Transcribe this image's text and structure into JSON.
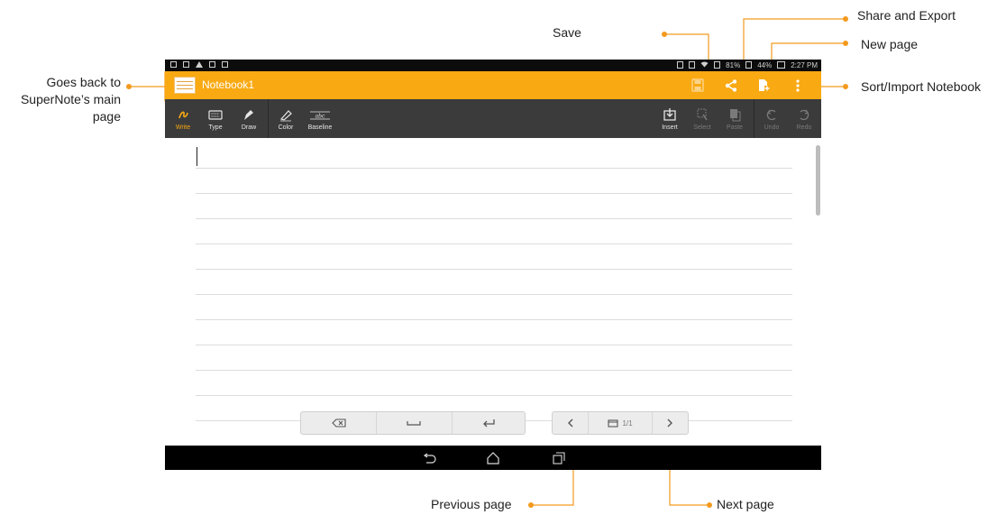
{
  "callouts": {
    "save": "Save",
    "share_export": "Share and Export",
    "new_page": "New page",
    "sort_import": "Sort/Import Notebook",
    "go_back_line1": "Goes back to",
    "go_back_line2": "SuperNote’s main",
    "go_back_line3": "page",
    "previous_page": "Previous page",
    "next_page": "Next page"
  },
  "status": {
    "battery_1": "81%",
    "battery_2": "44%",
    "time": "2:27 PM"
  },
  "appbar": {
    "title": "Notebook1",
    "icons": [
      "save-icon",
      "share-icon",
      "new-page-icon",
      "overflow-menu-icon"
    ]
  },
  "toolbar": {
    "write": "Write",
    "type": "Type",
    "draw": "Draw",
    "color": "Color",
    "baseline": "Baseline",
    "insert": "Insert",
    "select": "Select",
    "paste": "Paste",
    "undo": "Undo",
    "redo": "Redo"
  },
  "pager": {
    "page_indicator": "1/1"
  },
  "colors": {
    "accent": "#f9a912",
    "callout_dot": "#f39a1e",
    "toolbar_bg": "#3b3b3b"
  }
}
